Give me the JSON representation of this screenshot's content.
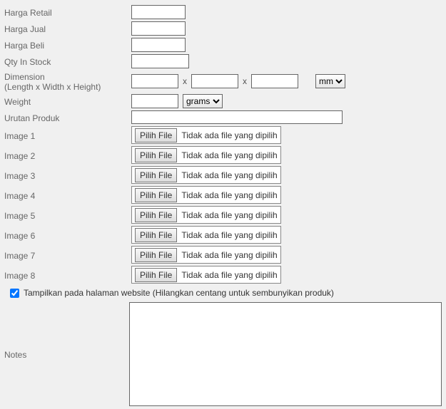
{
  "labels": {
    "harga_retail": "Harga Retail",
    "harga_jual": "Harga Jual",
    "harga_beli": "Harga Beli",
    "qty": "Qty In Stock",
    "dimension_line1": "Dimension",
    "dimension_line2": "(Length x Width x Height)",
    "weight": "Weight",
    "urutan": "Urutan Produk",
    "image1": "Image 1",
    "image2": "Image 2",
    "image3": "Image 3",
    "image4": "Image 4",
    "image5": "Image 5",
    "image6": "Image 6",
    "image7": "Image 7",
    "image8": "Image 8",
    "notes": "Notes",
    "tampilkan": "Tampilkan pada halaman website (Hilangkan centang untuk sembunyikan produk)",
    "x": "x"
  },
  "file_button": "Pilih File",
  "no_file": "Tidak ada file yang dipilih",
  "units": {
    "length": "mm",
    "weight": "grams"
  },
  "values": {
    "harga_retail": "",
    "harga_jual": "",
    "harga_beli": "",
    "qty": "",
    "len": "",
    "wid": "",
    "hei": "",
    "weight": "",
    "urutan": "",
    "notes": "",
    "file1": "",
    "file2": "",
    "file3": "",
    "file4": "",
    "file5": "",
    "file6": "",
    "file7": "",
    "file8": "",
    "tampilkan_checked": true
  }
}
